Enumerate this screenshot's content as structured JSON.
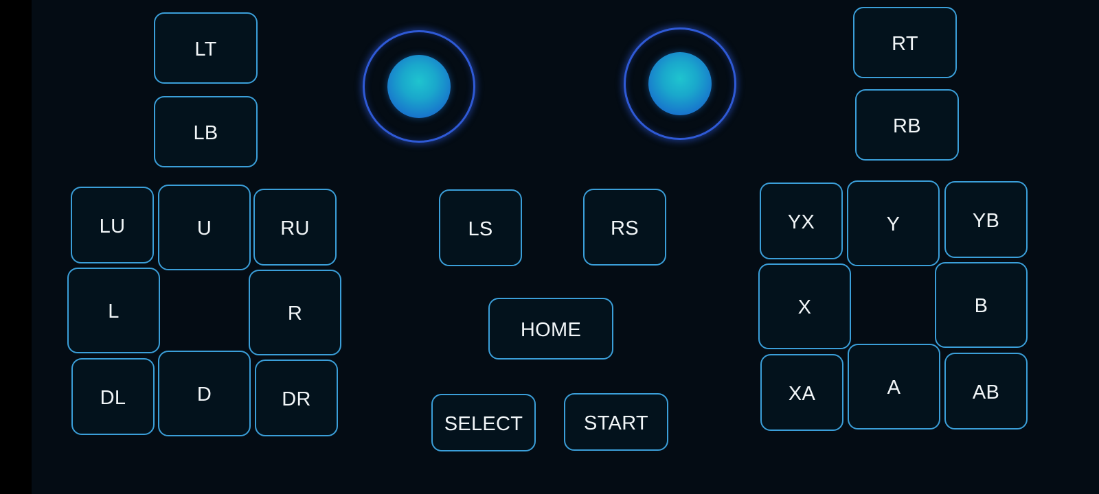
{
  "colors": {
    "background": "#040c14",
    "sidebar": "#000000",
    "button_border": "#3b9fd9",
    "button_fill": "#03121c",
    "button_text": "#f2f6f8",
    "stick_ring": "#2f5ad6",
    "stick_knob": "#1fc4cf"
  },
  "shoulders": {
    "lt": "LT",
    "lb": "LB",
    "rt": "RT",
    "rb": "RB"
  },
  "dpad": {
    "lu": "LU",
    "u": "U",
    "ru": "RU",
    "l": "L",
    "r": "R",
    "dl": "DL",
    "d": "D",
    "dr": "DR"
  },
  "center": {
    "ls": "LS",
    "rs": "RS",
    "home": "HOME",
    "select": "SELECT",
    "start": "START"
  },
  "face": {
    "yx": "YX",
    "y": "Y",
    "yb": "YB",
    "x": "X",
    "b": "B",
    "xa": "XA",
    "a": "A",
    "ab": "AB"
  },
  "sticks": {
    "left": "joystick-left-icon",
    "right": "joystick-right-icon"
  }
}
